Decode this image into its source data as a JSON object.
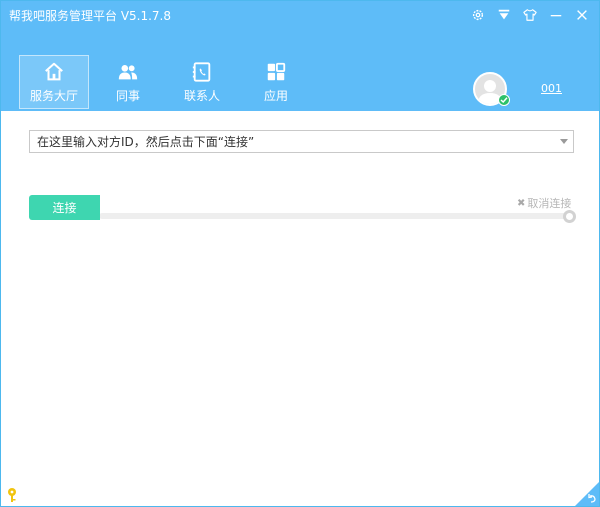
{
  "app": {
    "title": "帮我吧服务管理平台  V5.1.7.8"
  },
  "window_controls": {
    "settings": "gear-icon",
    "menu": "dropdown-arrow-icon",
    "skin": "tshirt-icon",
    "minimize": "minimize-icon",
    "close": "close-icon"
  },
  "nav": {
    "items": [
      {
        "label": "服务大厅",
        "icon": "home-icon",
        "active": true
      },
      {
        "label": "同事",
        "icon": "colleagues-icon",
        "active": false
      },
      {
        "label": "联系人",
        "icon": "contacts-icon",
        "active": false
      },
      {
        "label": "应用",
        "icon": "apps-icon",
        "active": false
      }
    ]
  },
  "user": {
    "id": "001",
    "status": "online"
  },
  "connect": {
    "placeholder": "在这里输入对方ID，然后点击下面“连接”",
    "button_label": "连接",
    "cancel_label": "取消连接",
    "progress": 0
  },
  "colors": {
    "header": "#5ebcf8",
    "connect_button": "#3ed6b0",
    "online": "#2dc16a"
  }
}
